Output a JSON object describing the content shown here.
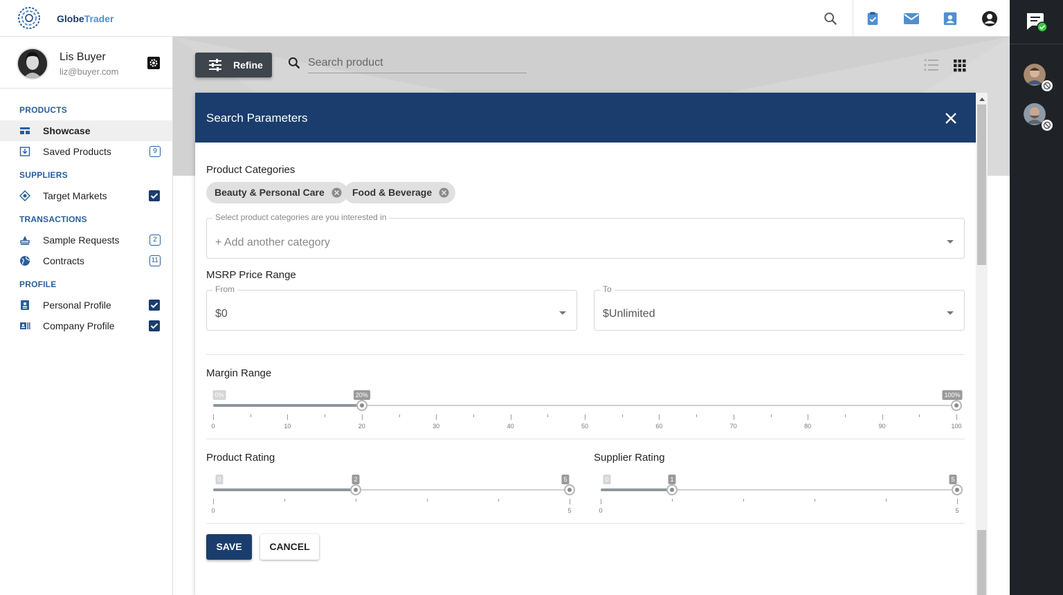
{
  "app": {
    "brand_part1": "Globe",
    "brand_part2": "Trader"
  },
  "user": {
    "name": "Lis Buyer",
    "email": "liz@buyer.com"
  },
  "sidebar": {
    "sections": [
      {
        "title": "PRODUCTS"
      },
      {
        "title": "SUPPLIERS"
      },
      {
        "title": "TRANSACTIONS"
      },
      {
        "title": "PROFILE"
      }
    ],
    "items": [
      {
        "label": "Showcase",
        "active": true
      },
      {
        "label": "Saved Products",
        "badge": "9"
      },
      {
        "label": "Target Markets",
        "checked": true
      },
      {
        "label": "Sample Requests",
        "badge": "2"
      },
      {
        "label": "Contracts",
        "badge": "11"
      },
      {
        "label": "Personal Profile",
        "checked": true
      },
      {
        "label": "Company Profile",
        "checked": true
      }
    ]
  },
  "toolbar": {
    "refine_label": "Refine",
    "search_placeholder": "Search product"
  },
  "modal": {
    "title": "Search Parameters",
    "product_categories_label": "Product Categories",
    "chips": [
      "Beauty & Personal Care",
      "Food & Beverage"
    ],
    "category_select_label": "Select product categories are you interested in",
    "category_select_placeholder": "+ Add another category",
    "msrp_label": "MSRP Price Range",
    "from_label": "From",
    "from_value": "$0",
    "to_label": "To",
    "to_value": "$Unlimited",
    "margin_label": "Margin Range",
    "margin": {
      "min": 0,
      "max": 100,
      "low": 20,
      "high": 100,
      "min_label": "0%",
      "low_label": "20%",
      "high_label": "100%",
      "tick_labels": [
        "0",
        "10",
        "20",
        "30",
        "40",
        "50",
        "60",
        "70",
        "80",
        "90",
        "100"
      ]
    },
    "product_rating_label": "Product Rating",
    "product_rating": {
      "min": 0,
      "max": 5,
      "low": 2,
      "high": 5,
      "min_label": "0",
      "low_label": "2",
      "high_label": "5",
      "tick_labels": [
        "0",
        "5"
      ]
    },
    "supplier_rating_label": "Supplier Rating",
    "supplier_rating": {
      "min": 0,
      "max": 5,
      "low": 1,
      "high": 5,
      "min_label": "0",
      "low_label": "1",
      "high_label": "5",
      "tick_labels": [
        "0",
        "5"
      ]
    },
    "save_label": "SAVE",
    "cancel_label": "CANCEL"
  },
  "colors": {
    "primary": "#1a3d6d",
    "accent": "#2a5e9a",
    "rail": "#1f2327",
    "online": "#2ecc40"
  },
  "icons": [
    "logo-icon",
    "search-icon",
    "tasks-icon",
    "mail-icon",
    "contacts-icon",
    "account-icon",
    "chat-icon",
    "settings-icon",
    "close-icon",
    "list-view-icon",
    "grid-view-icon",
    "filter-icon"
  ]
}
